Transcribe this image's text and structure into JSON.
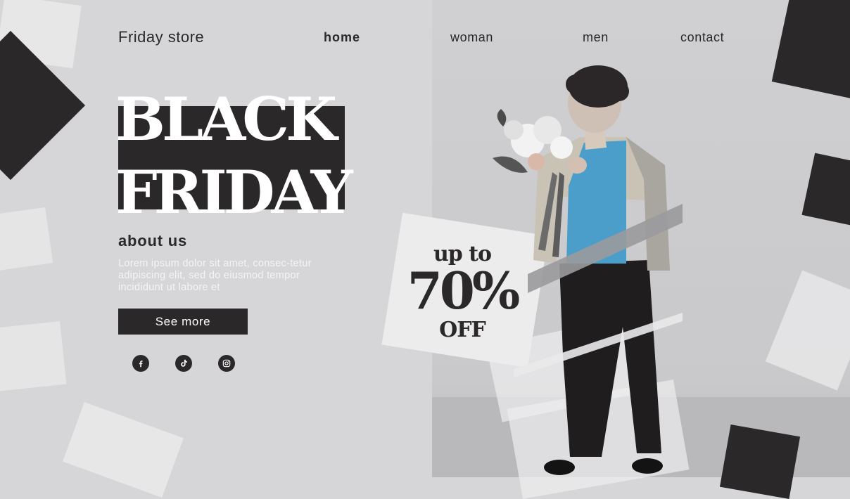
{
  "brand": "Friday store",
  "nav": {
    "home": "home",
    "woman": "woman",
    "men": "men",
    "contact": "contact"
  },
  "hero": {
    "line1": "BLACK",
    "line2": "FRIDAY"
  },
  "about": {
    "title": "about us",
    "text": "Lorem ipsum dolor sit amet, consec-tetur adipiscing elit, sed do eiusmod tempor incididunt ut labore et",
    "button": "See more"
  },
  "promo": {
    "line1": "up to",
    "line2": "70%",
    "line3": "OFF"
  },
  "social": [
    "facebook-icon",
    "tiktok-icon",
    "instagram-icon"
  ],
  "colors": {
    "dark": "#2b2829",
    "background": "#d6d6d8",
    "accent_blue": "#4a9ec9"
  }
}
